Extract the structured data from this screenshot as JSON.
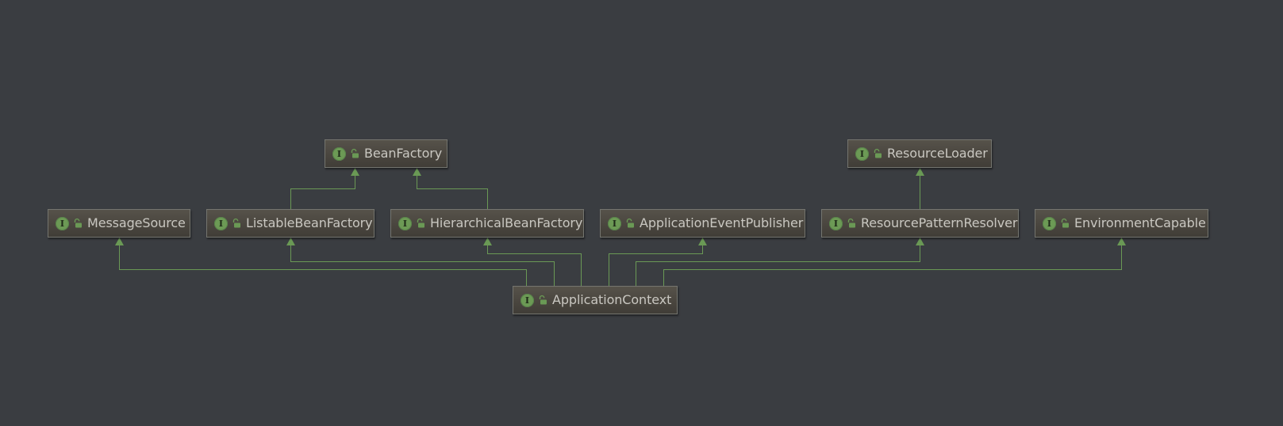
{
  "diagram": {
    "background_color": "#3a3d41",
    "edge_color": "#6a9955",
    "node_icon": "interface-icon",
    "node_icon_letter": "I",
    "visibility_icon": "public-lock-icon",
    "nodes": {
      "bean_factory": "BeanFactory",
      "resource_loader": "ResourceLoader",
      "message_source": "MessageSource",
      "listable_bean_factory": "ListableBeanFactory",
      "hierarchical_bean_factory": "HierarchicalBeanFactory",
      "application_event_publisher": "ApplicationEventPublisher",
      "resource_pattern_resolver": "ResourcePatternResolver",
      "environment_capable": "EnvironmentCapable",
      "application_context": "ApplicationContext"
    },
    "edges": [
      {
        "from": "listable_bean_factory",
        "to": "bean_factory",
        "relation": "extends"
      },
      {
        "from": "hierarchical_bean_factory",
        "to": "bean_factory",
        "relation": "extends"
      },
      {
        "from": "resource_pattern_resolver",
        "to": "resource_loader",
        "relation": "extends"
      },
      {
        "from": "application_context",
        "to": "message_source",
        "relation": "extends"
      },
      {
        "from": "application_context",
        "to": "listable_bean_factory",
        "relation": "extends"
      },
      {
        "from": "application_context",
        "to": "hierarchical_bean_factory",
        "relation": "extends"
      },
      {
        "from": "application_context",
        "to": "application_event_publisher",
        "relation": "extends"
      },
      {
        "from": "application_context",
        "to": "resource_pattern_resolver",
        "relation": "extends"
      },
      {
        "from": "application_context",
        "to": "environment_capable",
        "relation": "extends"
      }
    ]
  }
}
